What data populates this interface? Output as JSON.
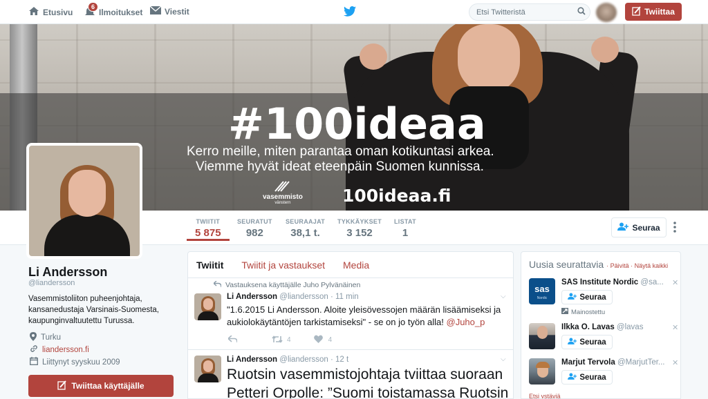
{
  "nav": {
    "home": "Etusivu",
    "notifications": "Ilmoitukset",
    "notifications_count": "6",
    "messages": "Viestit",
    "search_placeholder": "Etsi Twitteristä",
    "tweet_button": "Twiittaa"
  },
  "banner": {
    "hashtag": "#100ideaa",
    "line1": "Kerro meille, miten parantaa oman kotikuntasi arkea.",
    "line2": "Viemme hyvät ideat eteenpäin Suomen kunnissa.",
    "logo_text": "vasemmisto",
    "logo_sub": "vänstern",
    "site": "100ideaa.fi"
  },
  "stats": [
    {
      "label": "TWIITIT",
      "value": "5 875"
    },
    {
      "label": "SEURATUT",
      "value": "982"
    },
    {
      "label": "SEURAAJAT",
      "value": "38,1 t."
    },
    {
      "label": "TYKKÄYKSET",
      "value": "3 152"
    },
    {
      "label": "LISTAT",
      "value": "1"
    }
  ],
  "follow_button": "Seuraa",
  "profile": {
    "name": "Li Andersson",
    "handle": "@liandersson",
    "bio": "Vasemmistoliiton puheenjohtaja, kansanedustaja Varsinais-Suomesta, kaupunginvaltuutettu Turussa.",
    "location": "Turku",
    "url": "liandersson.fi",
    "joined": "Liittynyt syyskuu 2009",
    "tweet_to": "Twiittaa käyttäjälle"
  },
  "timeline": {
    "tabs": [
      "Twiitit",
      "Twiitit ja vastaukset",
      "Media"
    ],
    "tweets": [
      {
        "reply_context": "Vastauksena käyttäjälle Juho Pylvänäinen",
        "name": "Li Andersson",
        "handle": "@liandersson",
        "time": "· 11 min",
        "text": "\"1.6.2015 Li Andersson. Aloite yleisövessojen määrän lisäämiseksi ja aukiolokäytäntöjen tarkistamiseksi\" - se on jo työn alla! ",
        "mention": "@Juho_p",
        "retweets": "4",
        "likes": "4"
      },
      {
        "name": "Li Andersson",
        "handle": "@liandersson",
        "time": "· 12 t",
        "text": "Ruotsin vasemmistojohtaja tviittaa suoraan Petteri Orpolle: ”Suomi toistamassa Ruotsin"
      }
    ]
  },
  "who_to_follow": {
    "title": "Uusia seurattavia",
    "refresh": "Päivitä",
    "view_all": "Näytä kaikki",
    "dot": "·",
    "follow_label": "Seuraa",
    "promoted": "Mainostettu",
    "find_friends": "Etsi ystäviä",
    "accounts": [
      {
        "name": "SAS Institute Nordic",
        "handle": "@sa..."
      },
      {
        "name": "Ilkka O. Lavas",
        "handle": "@lavas"
      },
      {
        "name": "Marjut Tervola",
        "handle": "@MarjutTer..."
      }
    ]
  },
  "colors": {
    "accent": "#b2443d",
    "twitter_blue": "#1da1f2"
  }
}
